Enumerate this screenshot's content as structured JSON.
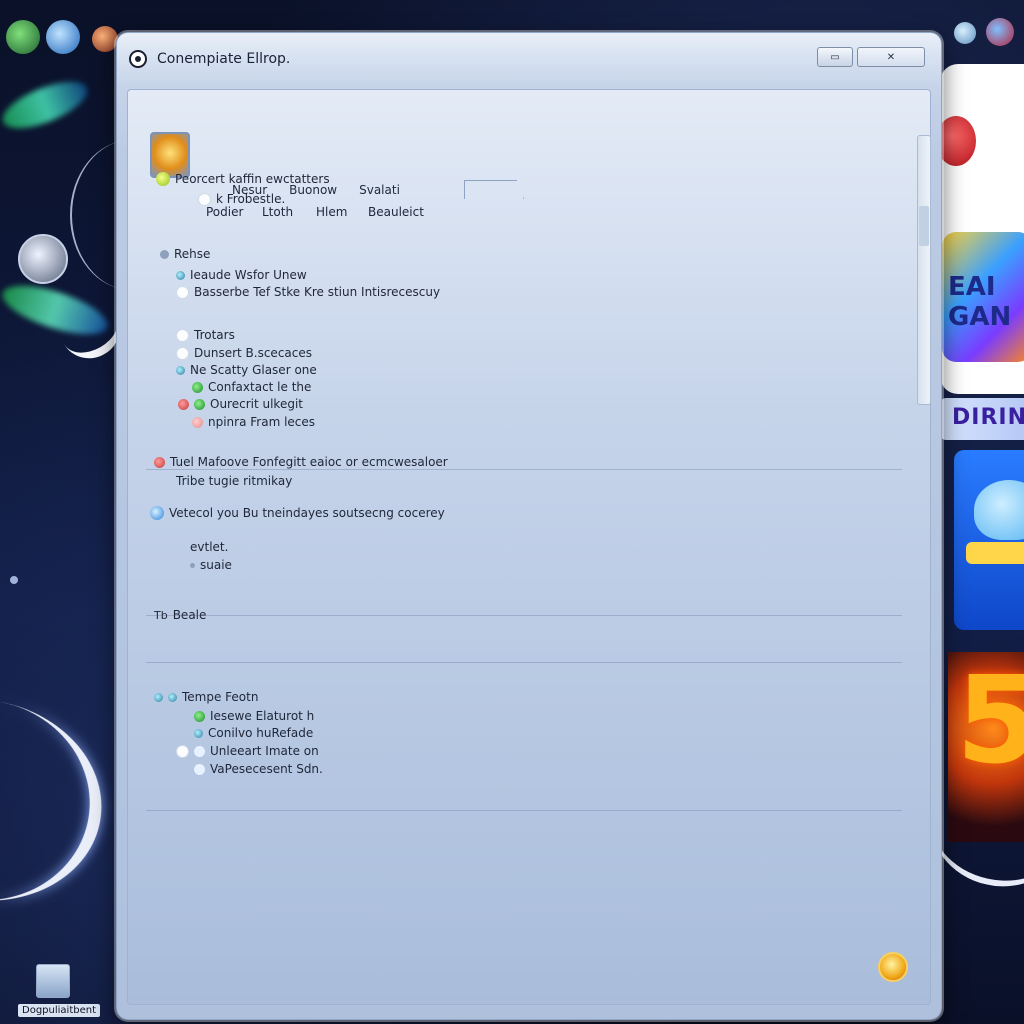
{
  "window": {
    "title": "Conempiate Ellrop."
  },
  "menubar": {
    "items": [
      "Nesur",
      "Buonow",
      "Svalati"
    ]
  },
  "toolbar": {
    "items": [
      "Podier",
      "Ltoth",
      "Hlem",
      "Beauleict"
    ]
  },
  "sections": [
    {
      "heading": "Peorcert kaffin ewctatters",
      "items": [
        "k Frobestle."
      ]
    },
    {
      "heading": "Rehse",
      "items": [
        "Ieaude Wsfor Unew",
        "Basserbe Tef Stke Kre stiun Intisrecescuy"
      ]
    },
    {
      "heading": "Trotars",
      "items": [
        "Dunsert B.scecaces",
        "Ne Scatty Glaser one",
        "Confaxtact le the",
        "Ourecrit ulkegit",
        "npinra Fram leces"
      ]
    },
    {
      "heading": "Tuel Mafoove Fonfegitt eaioc or ecmcwesaloer",
      "items": [
        "Tribe tugie ritmikay"
      ]
    },
    {
      "heading": "Vetecol you Bu tneindayes soutsecng cocerey",
      "items": [
        "evtlet.",
        "suaie"
      ]
    },
    {
      "heading": "Beale",
      "items": []
    },
    {
      "heading": "Tempe Feotn",
      "items": [
        "Iesewe Elaturot h",
        "Conilvo huRefade",
        "Unleeart Imate on",
        "VaPesecesent Sdn."
      ]
    }
  ],
  "taskbar": {
    "start_label": "Dogpuliaitbent"
  },
  "side_panels": {
    "game_logo": "EAI GAN",
    "strip_label": "DIRIN",
    "big_number": "5"
  }
}
